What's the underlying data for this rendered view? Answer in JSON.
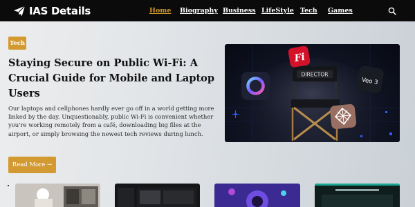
{
  "site": {
    "name": "IAS Details"
  },
  "nav": {
    "items": [
      {
        "label": "Home",
        "active": true
      },
      {
        "label": "Biography",
        "active": false
      },
      {
        "label": "Business",
        "active": false
      },
      {
        "label": "LifeStyle",
        "active": false
      },
      {
        "label": "Tech",
        "active": false
      },
      {
        "label": "Games",
        "active": false
      }
    ],
    "search_icon": "search-icon"
  },
  "featured": {
    "category": "Tech",
    "title": "Staying Secure on Public Wi-Fi: A Crucial Guide for Mobile and Laptop Users",
    "excerpt": "Our laptops and cellphones hardly ever go off in a world getting more linked by the day. Unquestionably, public Wi-Fi is convenient whether you're working remotely from a café, downloading big files at the airport, or simply browsing the newest tech reviews during lunch.",
    "read_more": "Read More →",
    "image_text": {
      "app_tile": "Fi",
      "chair_label": "DIRECTOR",
      "veo_tile": "Veo 3"
    }
  },
  "colors": {
    "accent": "#d49a32",
    "nav_active": "#d19a2c",
    "header_bg": "#0b0b0b"
  }
}
